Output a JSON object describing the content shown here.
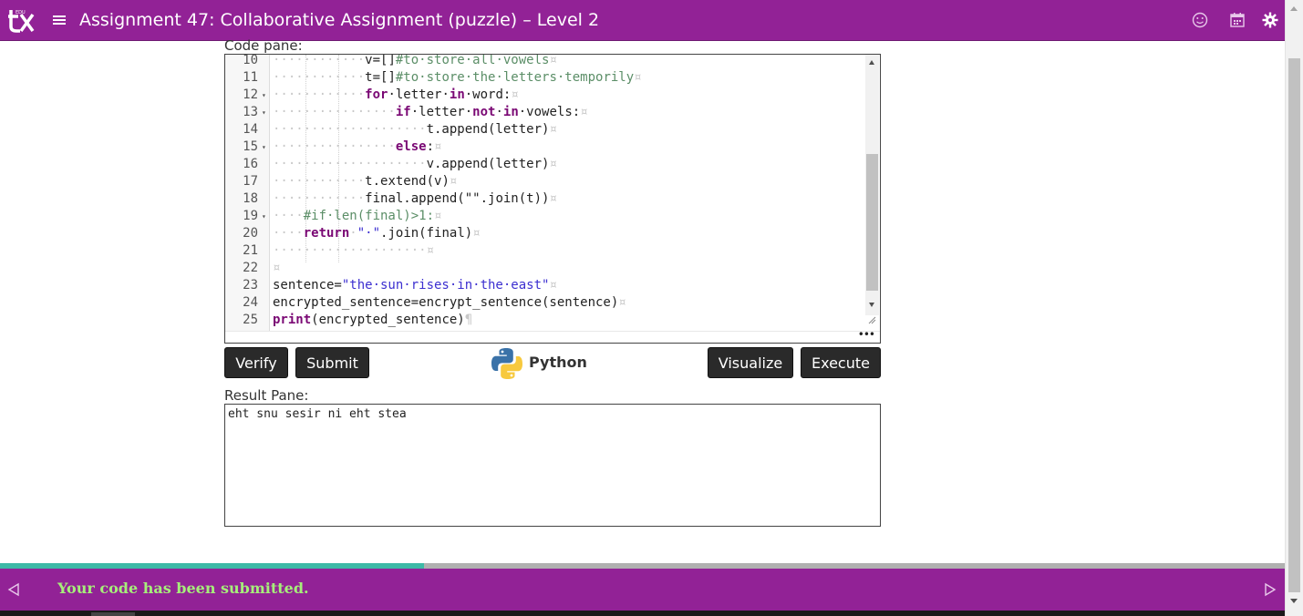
{
  "header": {
    "title": "Assignment 47: Collaborative Assignment (puzzle) – Level 2",
    "bg_color": "#922296",
    "icons": [
      "logo-icon",
      "hamburger-menu-icon",
      "smiley-icon",
      "calendar-icon",
      "gear-icon"
    ]
  },
  "code_pane": {
    "label": "Code pane:",
    "lines": [
      {
        "num": "10",
        "fold": ""
      },
      {
        "num": "11",
        "fold": ""
      },
      {
        "num": "12",
        "fold": "▾"
      },
      {
        "num": "13",
        "fold": "▾"
      },
      {
        "num": "14",
        "fold": ""
      },
      {
        "num": "15",
        "fold": "▾"
      },
      {
        "num": "16",
        "fold": ""
      },
      {
        "num": "17",
        "fold": ""
      },
      {
        "num": "18",
        "fold": ""
      },
      {
        "num": "19",
        "fold": "▾"
      },
      {
        "num": "20",
        "fold": ""
      },
      {
        "num": "21",
        "fold": ""
      },
      {
        "num": "22",
        "fold": ""
      },
      {
        "num": "23",
        "fold": ""
      },
      {
        "num": "24",
        "fold": ""
      },
      {
        "num": "25",
        "fold": ""
      }
    ],
    "code": {
      "l10": {
        "ws": "············",
        "a": "v=[]",
        "c": "#to·store·all·vowels",
        "p": "¤"
      },
      "l11": {
        "ws": "············",
        "a": "t=[]",
        "c": "#to·store·the·letters·temporily",
        "p": "¤"
      },
      "l12": {
        "ws": "············",
        "k1": "for",
        "a": "·letter·",
        "k2": "in",
        "b": "·word:",
        "p": "¤"
      },
      "l13": {
        "ws": "················",
        "k1": "if",
        "a": "·letter·",
        "k2": "not",
        "b": "·",
        "k3": "in",
        "c": "·vowels:",
        "p": "¤"
      },
      "l14": {
        "ws": "····················",
        "a": "t.append(letter)",
        "p": "¤"
      },
      "l15": {
        "ws": "················",
        "k1": "else",
        "a": ":",
        "p": "¤"
      },
      "l16": {
        "ws": "····················",
        "a": "v.append(letter)",
        "p": "¤"
      },
      "l17": {
        "ws": "············",
        "a": "t.extend(v)",
        "p": "¤"
      },
      "l18": {
        "ws": "············",
        "a": "final.append(\"\".join(t))",
        "p": "¤"
      },
      "l19": {
        "ws": "····",
        "c": "#if·len(final)>1:",
        "p": "¤"
      },
      "l20": {
        "ws": "····",
        "k1": "return",
        "a": "·",
        "s": "\"·\"",
        "b": ".join(final)",
        "p": "¤"
      },
      "l21": {
        "ws": "····················",
        "p": "¤"
      },
      "l22": {
        "p": "¤"
      },
      "l23": {
        "a": "sentence=",
        "s": "\"the·sun·rises·in·the·east\"",
        "p": "¤"
      },
      "l24": {
        "a": "encrypted_sentence=encrypt_sentence(sentence)",
        "p": "¤"
      },
      "l25": {
        "k1": "print",
        "a": "(encrypted_sentence)",
        "p": "¶"
      }
    }
  },
  "buttons": {
    "verify": "Verify",
    "submit": "Submit",
    "visualize": "Visualize",
    "execute": "Execute"
  },
  "language": {
    "label": "Python",
    "icon": "python-logo-icon"
  },
  "result_pane": {
    "label": "Result Pane:",
    "output": "eht snu sesir ni eht stea"
  },
  "footer": {
    "message": "Your code has been submitted.",
    "progress": 0.33,
    "bg_color": "#922296",
    "progress_color": "#3db9a6",
    "message_color": "#a6ee7a"
  }
}
